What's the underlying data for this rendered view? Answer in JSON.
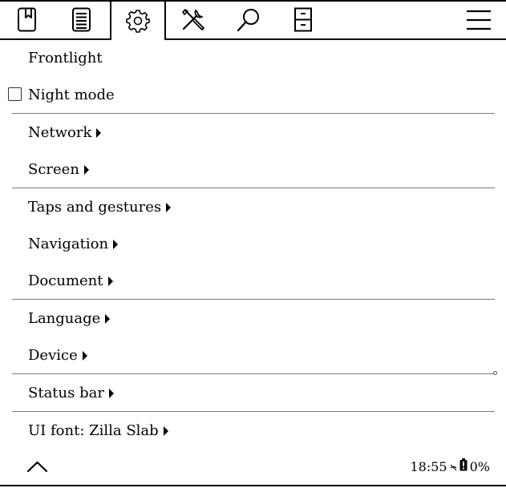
{
  "tabs": [
    {
      "name": "bookmark-icon"
    },
    {
      "name": "document-list-icon"
    },
    {
      "name": "gear-icon",
      "active": true
    },
    {
      "name": "tools-icon"
    },
    {
      "name": "search-icon"
    },
    {
      "name": "filing-cabinet-icon"
    },
    {
      "name": "hamburger-menu-icon"
    }
  ],
  "menu": {
    "frontlight": "Frontlight",
    "night_mode": "Night mode",
    "night_mode_checked": false,
    "network": "Network",
    "screen": "Screen",
    "taps_and_gestures": "Taps and gestures",
    "navigation": "Navigation",
    "document": "Document",
    "language": "Language",
    "device": "Device",
    "status_bar": "Status bar",
    "ui_font": "UI font: Zilla Slab"
  },
  "footer": {
    "time": "18:55",
    "battery": "0%",
    "icons": [
      "up-chevron-icon",
      "wifi-off-icon",
      "battery-alert-icon"
    ]
  }
}
